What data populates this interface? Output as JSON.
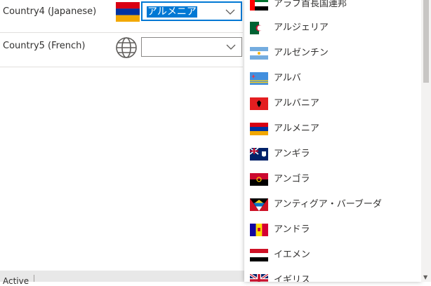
{
  "form": {
    "rows": [
      {
        "label": "Country4 (Japanese)",
        "value": "アルメニア",
        "flag": "flag-armenia-icon"
      },
      {
        "label": "Country5 (French)",
        "value": "",
        "flag": "globe-icon"
      }
    ]
  },
  "status_bar": {
    "text": "Active"
  },
  "dropdown": {
    "items": [
      {
        "label": "アラブ首長国連邦",
        "flag": "flag-uae-icon"
      },
      {
        "label": "アルジェリア",
        "flag": "flag-algeria-icon"
      },
      {
        "label": "アルゼンチン",
        "flag": "flag-argentina-icon"
      },
      {
        "label": "アルバ",
        "flag": "flag-aruba-icon"
      },
      {
        "label": "アルバニア",
        "flag": "flag-albania-icon"
      },
      {
        "label": "アルメニア",
        "flag": "flag-armenia-icon"
      },
      {
        "label": "アンギラ",
        "flag": "flag-anguilla-icon"
      },
      {
        "label": "アンゴラ",
        "flag": "flag-angola-icon"
      },
      {
        "label": "アンティグア・バーブーダ",
        "flag": "flag-antigua-icon"
      },
      {
        "label": "アンドラ",
        "flag": "flag-andorra-icon"
      },
      {
        "label": "イエメン",
        "flag": "flag-yemen-icon"
      },
      {
        "label": "イギリス",
        "flag": "flag-uk-icon"
      }
    ]
  },
  "colors": {
    "accent": "#0078d4",
    "border": "#8a8886",
    "divider": "#e1dfdd"
  }
}
